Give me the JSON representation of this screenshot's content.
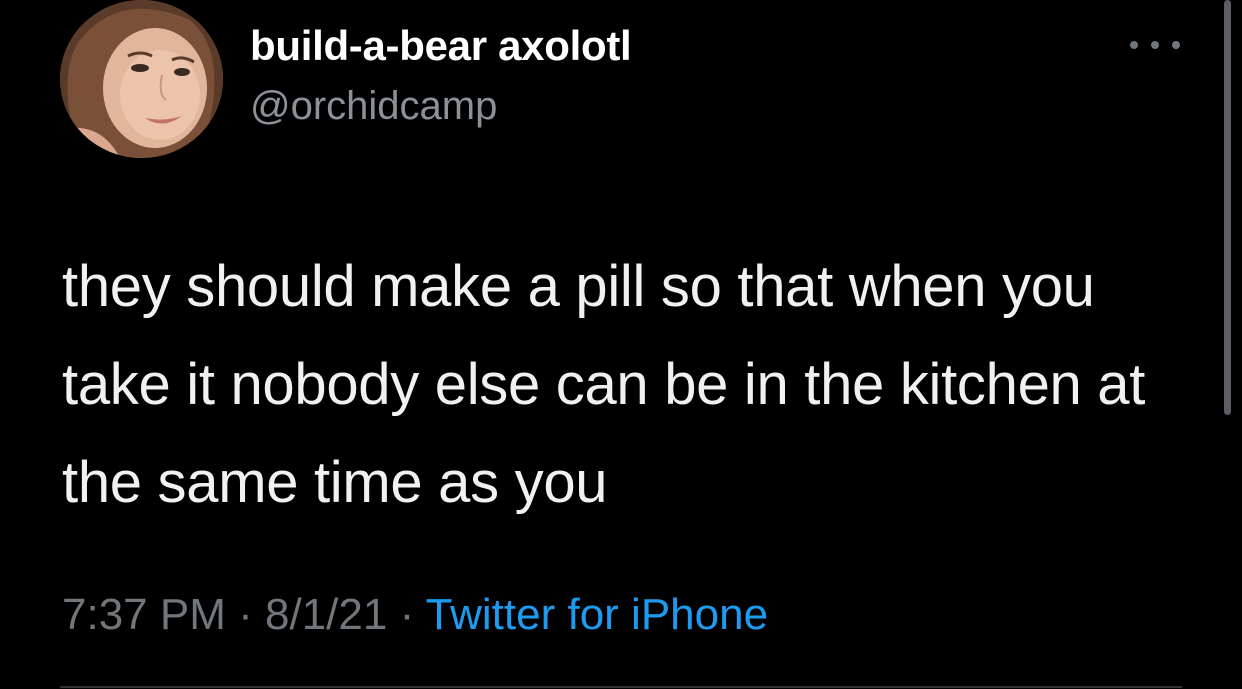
{
  "user": {
    "display_name": "build-a-bear axolotl",
    "handle": "@orchidcamp"
  },
  "tweet": {
    "text": "they should make a pill so that when you take it nobody else can be in the kitchen at the same time as you",
    "time": "7:37 PM",
    "separator": "·",
    "date": "8/1/21",
    "source": "Twitter for iPhone"
  },
  "colors": {
    "background": "#000000",
    "link": "#1d9bf0",
    "muted": "#71767b"
  },
  "icons": {
    "more": "more-horizontal-icon"
  }
}
